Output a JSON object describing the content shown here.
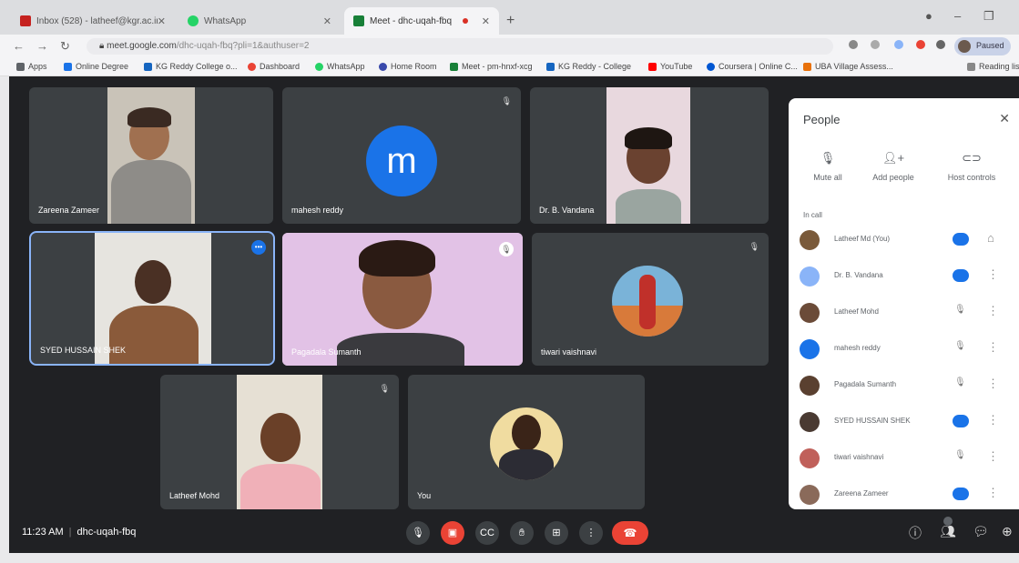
{
  "browser": {
    "tabs": [
      {
        "label": "Inbox (528) - latheef@kgr.ac.in",
        "color": "#c5221f"
      },
      {
        "label": "WhatsApp",
        "color": "#25d366"
      },
      {
        "label": "Meet - dhc-uqah-fbq",
        "color": "#188038"
      }
    ],
    "new_tab_label": "+",
    "url_host": "meet.google.com",
    "url_path": "/dhc-uqah-fbq?pli=1&authuser=2",
    "profile_label": "Paused"
  },
  "bookmarks": [
    {
      "label": "Apps",
      "color": "#5f6368"
    },
    {
      "label": "Online Degree",
      "color": "#1a73e8"
    },
    {
      "label": "KG Reddy College o...",
      "color": "#1565c0"
    },
    {
      "label": "Dashboard",
      "color": "#ea4335"
    },
    {
      "label": "WhatsApp",
      "color": "#25d366"
    },
    {
      "label": "Home Room",
      "color": "#3949ab"
    },
    {
      "label": "Meet - pm-hnxf-xcg",
      "color": "#188038"
    },
    {
      "label": "KG Reddy - College",
      "color": "#1565c0"
    },
    {
      "label": "YouTube",
      "color": "#ff0000"
    },
    {
      "label": "Coursera | Online C...",
      "color": "#0056d2"
    },
    {
      "label": "UBA Village Assess...",
      "color": "#e8710a"
    }
  ],
  "bookmarks_other": "Reading list",
  "participants": {
    "t1": "Zareena Zameer",
    "t2": "mahesh reddy",
    "t2_initial": "m",
    "t3": "Dr. B. Vandana",
    "t4": "SYED HUSSAIN SHEK",
    "t5": "Pagadala Sumanth",
    "t6": "tiwari vaishnavi",
    "t7": "Latheef Mohd",
    "t8": "You"
  },
  "panel": {
    "title": "People",
    "mute_all": "Mute all",
    "add_people": "Add people",
    "host_controls": "Host controls",
    "in_call": "In call",
    "list": [
      {
        "name": "Latheef Md (You)",
        "color": "#7a5a3a"
      },
      {
        "name": "Dr. B. Vandana",
        "color": "#8ab4f8"
      },
      {
        "name": "Latheef Mohd",
        "color": "#6b4b38"
      },
      {
        "name": "mahesh reddy",
        "color": "#1a73e8"
      },
      {
        "name": "Pagadala Sumanth",
        "color": "#5a4030"
      },
      {
        "name": "SYED HUSSAIN SHEK",
        "color": "#4a3a32"
      },
      {
        "name": "tiwari vaishnavi",
        "color": "#c0605a"
      },
      {
        "name": "Zareena Zameer",
        "color": "#8a6a5a"
      }
    ]
  },
  "meeting": {
    "time": "11:23 AM",
    "code": "dhc-uqah-fbq"
  }
}
